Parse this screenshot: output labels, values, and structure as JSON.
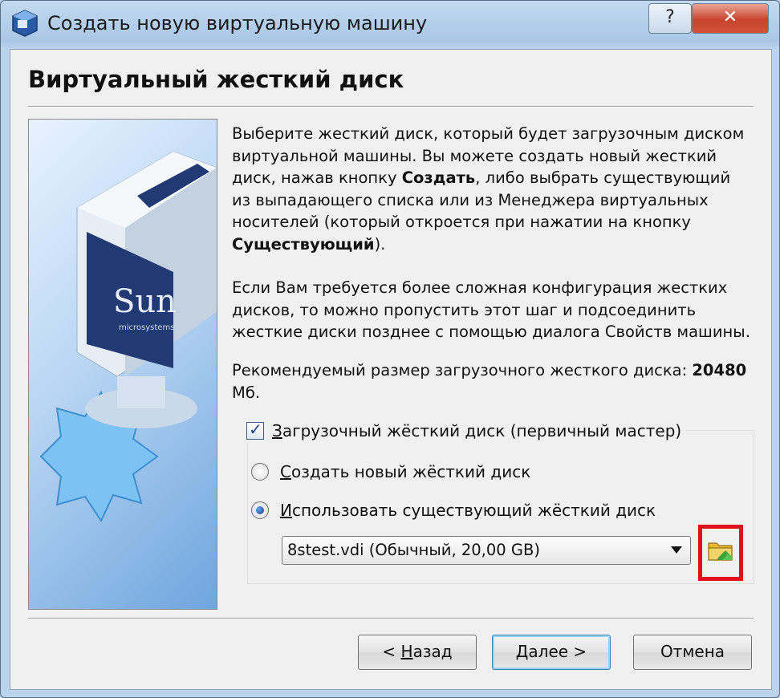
{
  "window": {
    "title": "Создать новую виртуальную машину",
    "help_label": "?",
    "close_label": "✕"
  },
  "page": {
    "title": "Виртуальный жесткий диск"
  },
  "description": {
    "p1_a": "Выберите жесткий диск, который будет загрузочным диском виртуальной машины. Вы можете создать новый жесткий диск, нажав кнопку ",
    "p1_bold1": "Создать",
    "p1_b": ", либо выбрать существующий из выпадающего списка или из Менеджера виртуальных носителей (который откроется при нажатии на кнопку ",
    "p1_bold2": "Существующий",
    "p1_c": ").",
    "p2": "Если Вам требуется более сложная конфигурация жестких дисков, то можно пропустить этот шаг и подсоединить жесткие диски позднее с помощью диалога Свойств машины.",
    "p3_a": "Рекомендуемый размер загрузочного жесткого диска: ",
    "p3_bold": "20480",
    "p3_b": " Мб."
  },
  "boot_disk": {
    "checkbox_label_u": "З",
    "checkbox_label_rest": "агрузочный жёсткий диск (первичный мастер)",
    "checked": true
  },
  "options": {
    "create_u": "С",
    "create_rest": "оздать новый жёсткий диск",
    "use_existing_u": "И",
    "use_existing_rest": "спользовать существующий жёсткий диск",
    "selected": "use_existing"
  },
  "disk_select": {
    "value": "8stest.vdi (Обычный, 20,00 GB)"
  },
  "buttons": {
    "back_prefix": "< ",
    "back_u": "Н",
    "back_rest": "азад",
    "next_u": "Д",
    "next_rest": "алее >",
    "cancel": "Отмена"
  },
  "side_image": {
    "logo_text": "Sun",
    "logo_sub": "microsystems"
  },
  "colors": {
    "highlight_frame": "#e0101e",
    "close_button": "#c8432c"
  }
}
